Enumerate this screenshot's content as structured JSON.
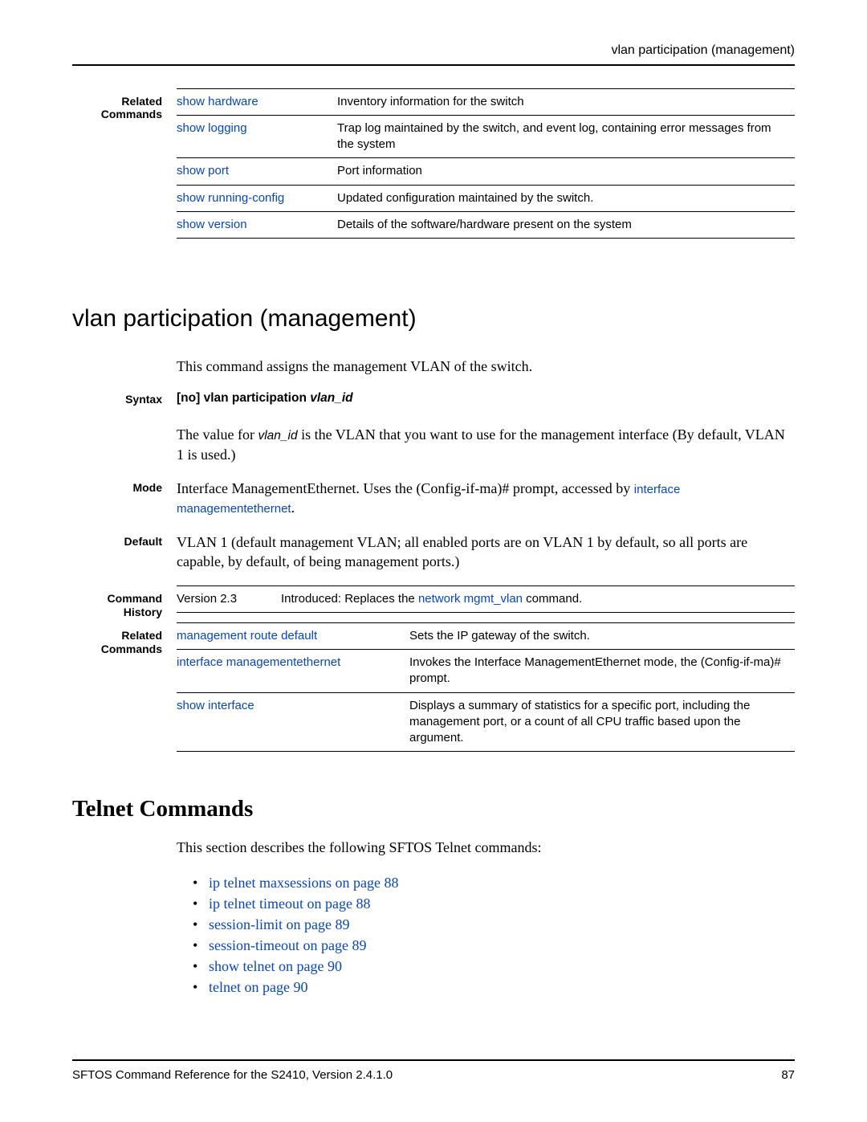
{
  "header": {
    "title": "vlan participation (management)"
  },
  "related1": {
    "label": "Related\nCommands",
    "rows": [
      {
        "cmd": "show hardware",
        "desc": "Inventory information for the switch"
      },
      {
        "cmd": "show logging",
        "desc": "Trap log maintained by the switch, and event log, containing error messages from the system"
      },
      {
        "cmd": "show port",
        "desc": "Port information"
      },
      {
        "cmd": "show running-config",
        "desc": "Updated configuration maintained by the switch."
      },
      {
        "cmd": "show version",
        "desc": "Details of the software/hardware present on the system"
      }
    ]
  },
  "section1": {
    "title": "vlan participation (management)",
    "intro": "This command assigns the management VLAN of the switch.",
    "syntax_label": "Syntax",
    "syntax_prefix": "[no] vlan participation ",
    "syntax_param": "vlan_id",
    "syntax_desc_a": "The value for ",
    "syntax_desc_param": "vlan_id",
    "syntax_desc_b": " is the VLAN that you want to use for the management interface (By default, VLAN 1 is used.)",
    "mode_label": "Mode",
    "mode_text_a": "Interface ManagementEthernet. Uses the (Config-if-ma)# prompt, accessed by ",
    "mode_link": "interface managementethernet",
    "mode_text_b": ".",
    "default_label": "Default",
    "default_text": "VLAN 1 (default management VLAN; all enabled ports are on VLAN 1 by default, so all ports are capable, by default, of being management ports.)",
    "history_label": "Command\nHistory",
    "history": {
      "ver": "Version 2.3",
      "text_a": "Introduced: Replaces the ",
      "text_link": "network mgmt_vlan",
      "text_b": " command."
    },
    "related_label": "Related\nCommands",
    "related2": [
      {
        "cmd": "management route default",
        "desc": "Sets the IP gateway of the switch."
      },
      {
        "cmd": "interface managementethernet",
        "desc": "Invokes the Interface ManagementEthernet mode, the (Config-if-ma)# prompt."
      },
      {
        "cmd": "show interface",
        "desc": "Displays a summary of statistics for a specific port, including the management port, or a count of all CPU traffic based upon the argument."
      }
    ]
  },
  "telnet": {
    "title": "Telnet Commands",
    "intro": "This section describes the following SFTOS Telnet commands:",
    "items": [
      "ip telnet maxsessions on page 88",
      "ip telnet timeout on page 88",
      "session-limit on page 89",
      "session-timeout on page 89",
      "show telnet on page 90",
      "telnet on page 90"
    ]
  },
  "footer": {
    "left": "SFTOS Command Reference for the S2410, Version 2.4.1.0",
    "right": "87"
  }
}
